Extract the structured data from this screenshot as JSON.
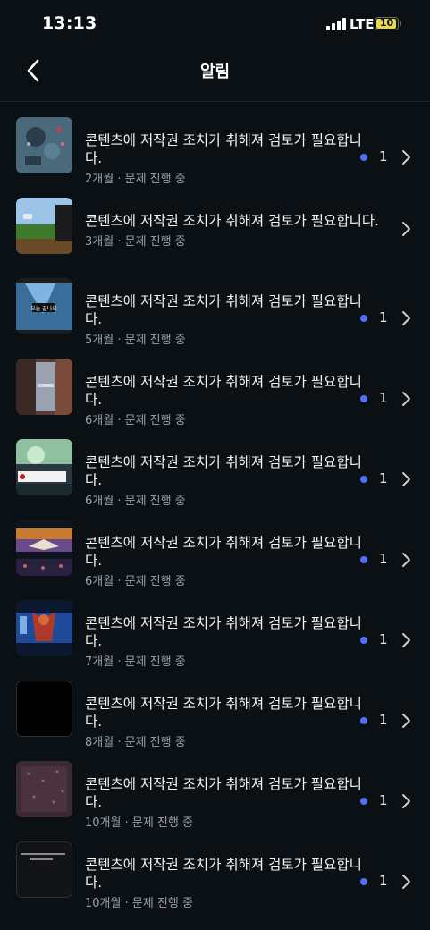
{
  "status": {
    "time": "13:13",
    "network": "LTE",
    "battery": "10",
    "battery_level": 0.1
  },
  "header": {
    "title": "알림"
  },
  "notifications": [
    {
      "message": "콘텐츠에 저작권 조치가 취해져 검토가 필요합니\n다.",
      "age": "2개월",
      "status": "문제 진행 중",
      "count": "1",
      "unread": true
    },
    {
      "message": "콘텐츠에 저작권 조치가 취해져 검토가 필요합니다.",
      "age": "3개월",
      "status": "문제 진행 중",
      "count": "",
      "unread": false
    },
    {
      "message": "콘텐츠에 저작권 조치가 취해져 검토가 필요합니\n다.",
      "age": "5개월",
      "status": "문제 진행 중",
      "count": "1",
      "unread": true,
      "thumb_text": "오늘 끝나요"
    },
    {
      "message": "콘텐츠에 저작권 조치가 취해져 검토가 필요합니\n다.",
      "age": "6개월",
      "status": "문제 진행 중",
      "count": "1",
      "unread": true
    },
    {
      "message": "콘텐츠에 저작권 조치가 취해져 검토가 필요합니\n다.",
      "age": "6개월",
      "status": "문제 진행 중",
      "count": "1",
      "unread": true
    },
    {
      "message": "콘텐츠에 저작권 조치가 취해져 검토가 필요합니\n다.",
      "age": "6개월",
      "status": "문제 진행 중",
      "count": "1",
      "unread": true
    },
    {
      "message": "콘텐츠에 저작권 조치가 취해져 검토가 필요합니\n다.",
      "age": "7개월",
      "status": "문제 진행 중",
      "count": "1",
      "unread": true
    },
    {
      "message": "콘텐츠에 저작권 조치가 취해져 검토가 필요합니\n다.",
      "age": "8개월",
      "status": "문제 진행 중",
      "count": "1",
      "unread": true
    },
    {
      "message": "콘텐츠에 저작권 조치가 취해져 검토가 필요합니\n다.",
      "age": "10개월",
      "status": "문제 진행 중",
      "count": "1",
      "unread": true
    },
    {
      "message": "콘텐츠에 저작권 조치가 취해져 검토가 필요합니\n다.",
      "age": "10개월",
      "status": "문제 진행 중",
      "count": "1",
      "unread": true
    }
  ],
  "colors": {
    "background": "#0b1014",
    "unread_dot": "#4f6ff5",
    "meta_text": "#9aa0a6"
  }
}
